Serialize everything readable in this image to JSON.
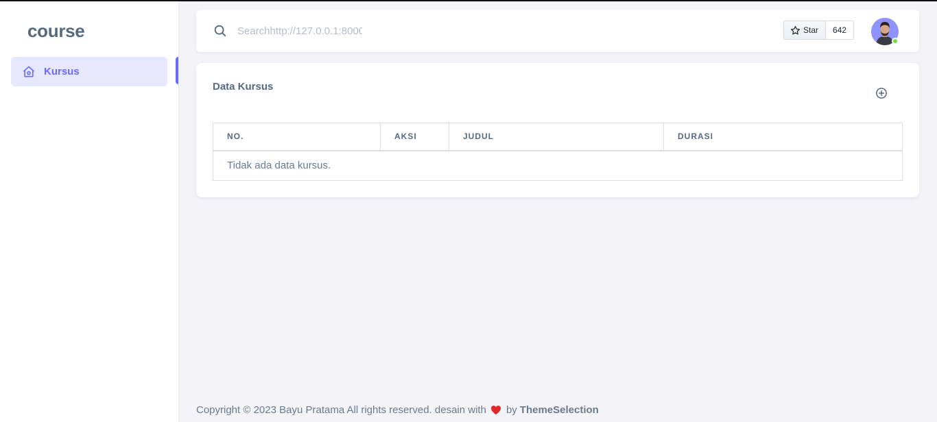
{
  "sidebar": {
    "brand": "course",
    "items": [
      {
        "label": "Kursus",
        "icon": "home-icon",
        "active": true
      }
    ]
  },
  "navbar": {
    "search": {
      "placeholder": "Searchhttp://127.0.0.1:8000"
    },
    "github": {
      "star_label": "Star",
      "star_count": "642"
    },
    "avatar": {
      "status": "online"
    }
  },
  "card": {
    "title": "Data Kursus",
    "add_icon": "plus-circle-icon",
    "table": {
      "headers": [
        "NO.",
        "AKSI",
        "JUDUL",
        "DURASI"
      ],
      "empty_message": "Tidak ada data kursus."
    }
  },
  "footer": {
    "text": "Copyright © 2023 Bayu Pratama All rights reserved. desain with",
    "by": "by",
    "link": "ThemeSelection"
  },
  "colors": {
    "accent": "#696cff",
    "accent_light": "#e7e7ff",
    "background": "#f4f4f8",
    "heart": "#e3262b",
    "online": "#71dd37"
  }
}
